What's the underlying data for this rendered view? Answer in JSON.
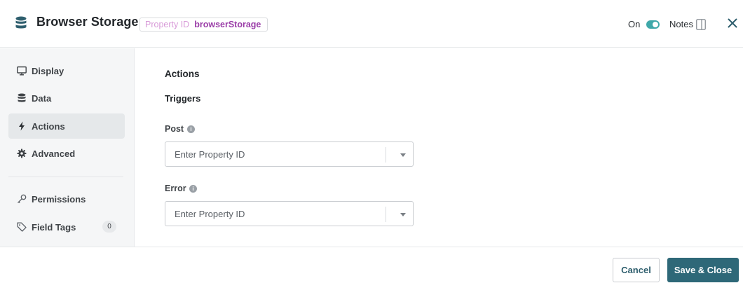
{
  "header": {
    "title": "Browser Storage",
    "icon": "database-icon",
    "property_id_label": "Property ID",
    "property_id_value": "browserStorage",
    "toggle_label": "On",
    "toggle_state": true,
    "notes_label": "Notes"
  },
  "sidebar": {
    "items": [
      {
        "label": "Display",
        "icon": "monitor-icon",
        "active": false
      },
      {
        "label": "Data",
        "icon": "database-icon",
        "active": false
      },
      {
        "label": "Actions",
        "icon": "lightning-icon",
        "active": true
      },
      {
        "label": "Advanced",
        "icon": "gear-icon",
        "active": false
      },
      {
        "label": "Permissions",
        "icon": "key-icon",
        "active": false
      },
      {
        "label": "Field Tags",
        "icon": "tag-icon",
        "active": false,
        "badge": "0"
      }
    ]
  },
  "main": {
    "section_title": "Actions",
    "subsection_title": "Triggers",
    "fields": [
      {
        "label": "Post",
        "placeholder": "Enter Property ID"
      },
      {
        "label": "Error",
        "placeholder": "Enter Property ID"
      }
    ]
  },
  "footer": {
    "cancel_label": "Cancel",
    "save_label": "Save & Close"
  },
  "colors": {
    "accent": "#3fa8a9",
    "primary_button": "#2e6878",
    "property_value": "#9b3ea8",
    "property_key": "#d89ad8"
  }
}
